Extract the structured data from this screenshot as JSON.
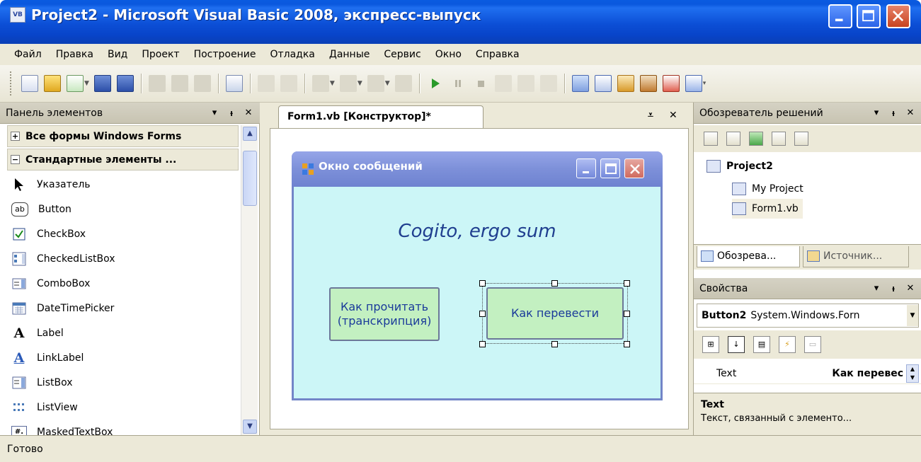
{
  "window": {
    "title": "Project2 - Microsoft Visual Basic 2008, экспресс-выпуск",
    "icon_text": "VB"
  },
  "menu": [
    "Файл",
    "Правка",
    "Вид",
    "Проект",
    "Построение",
    "Отладка",
    "Данные",
    "Сервис",
    "Окно",
    "Справка"
  ],
  "toolbox": {
    "title": "Панель элементов",
    "groups": [
      {
        "label": "Все формы Windows Forms",
        "expanded": false
      },
      {
        "label": "Стандартные элементы ...",
        "expanded": true
      }
    ],
    "items": [
      {
        "label": "Указатель",
        "icon": "pointer-icon"
      },
      {
        "label": "Button",
        "icon": "button-icon"
      },
      {
        "label": "CheckBox",
        "icon": "checkbox-icon"
      },
      {
        "label": "CheckedListBox",
        "icon": "checkedlistbox-icon"
      },
      {
        "label": "ComboBox",
        "icon": "combobox-icon"
      },
      {
        "label": "DateTimePicker",
        "icon": "datetimepicker-icon"
      },
      {
        "label": "Label",
        "icon": "label-icon"
      },
      {
        "label": "LinkLabel",
        "icon": "linklabel-icon"
      },
      {
        "label": "ListBox",
        "icon": "listbox-icon"
      },
      {
        "label": "ListView",
        "icon": "listview-icon"
      },
      {
        "label": "MaskedTextBox",
        "icon": "maskedtextbox-icon"
      }
    ]
  },
  "designer": {
    "tab_label": "Form1.vb [Конструктор]*",
    "form": {
      "title": "Окно сообщений",
      "caption": "Cogito, ergo sum",
      "button1": "Как прочитать (транскрипция)",
      "button2": "Как перевести"
    }
  },
  "solution_explorer": {
    "title": "Обозреватель решений",
    "project": "Project2",
    "items": [
      "My Project",
      "Form1.vb"
    ],
    "tabs": [
      "Обозрева...",
      "Источник..."
    ]
  },
  "properties": {
    "title": "Свойства",
    "object_name": "Button2",
    "object_type": "System.Windows.Forn",
    "property_name": "Text",
    "property_value": "Как перевес",
    "desc_title": "Text",
    "desc_text": "Текст, связанный с элементо..."
  },
  "status": "Готово",
  "colors": {
    "title_bar": "#0a4fd6",
    "chrome": "#ece9d8",
    "form_bg": "#ccf6f7",
    "form_button_bg": "#c3f0c1",
    "form_text": "#1f3e8f"
  }
}
